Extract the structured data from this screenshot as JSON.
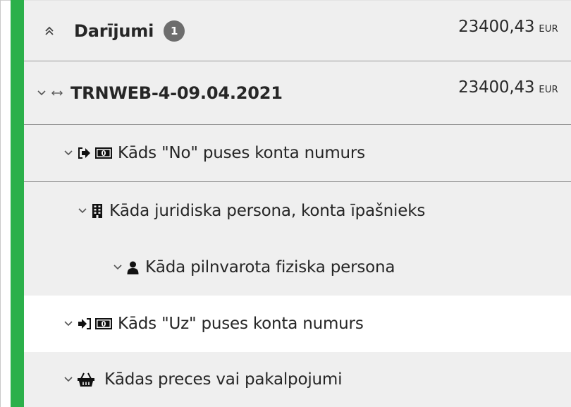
{
  "colors": {
    "accent_green": "#2bb04a",
    "badge_bg": "#6d6d6d",
    "row_grey": "#efefef",
    "row_white": "#ffffff"
  },
  "header": {
    "title": "Darījumi",
    "badge_count": "1",
    "amount": "23400,43",
    "currency": "EUR",
    "collapse_icon": "double-chevron-up-icon"
  },
  "transaction": {
    "id": "TRNWEB-4-09.04.2021",
    "amount": "23400,43",
    "currency": "EUR",
    "icon": "left-right-arrow-icon"
  },
  "tree": [
    {
      "label": "Kāds \"No\" puses konta numurs",
      "icons": [
        "sign-out-icon",
        "money-bill-icon"
      ]
    },
    {
      "label": "Kāda juridiska persona, konta īpašnieks",
      "icons": [
        "building-icon"
      ]
    },
    {
      "label": "Kāda pilnvarota fiziska persona",
      "icons": [
        "user-icon"
      ]
    },
    {
      "label": "Kāds \"Uz\" puses konta numurs",
      "icons": [
        "sign-in-icon",
        "money-bill-icon"
      ]
    },
    {
      "label": "Kādas preces vai pakalpojumi",
      "icons": [
        "shopping-basket-icon"
      ]
    }
  ]
}
